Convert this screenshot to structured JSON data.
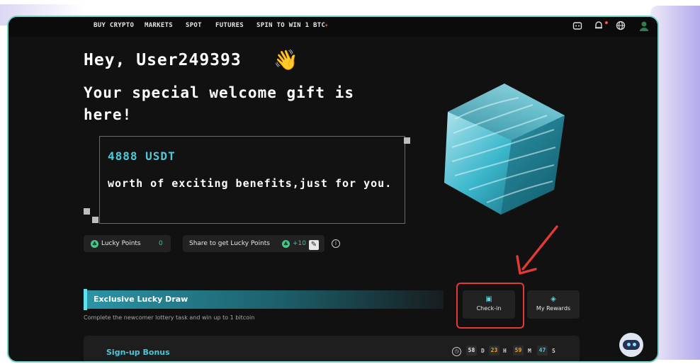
{
  "nav": {
    "items": [
      "BUY CRYPTO",
      "MARKETS",
      "SPOT",
      "FUTURES",
      "SPIN TO WIN 1 BTC"
    ],
    "icons": [
      "gift-icon",
      "bell-icon",
      "globe-icon",
      "avatar-icon"
    ]
  },
  "hero": {
    "greeting": "Hey, User249393",
    "wave_emoji": "👋",
    "welcome": "Your special welcome gift is here!",
    "gift_amount": "4888 USDT",
    "gift_desc": "worth of exciting benefits,just for you."
  },
  "lucky_points": {
    "label": "Lucky Points",
    "value": "0",
    "share_label": "Share to get Lucky Points",
    "share_bonus": "+10"
  },
  "lucky_draw": {
    "title": "Exclusive Lucky Draw",
    "subtitle": "Complete the newcomer lottery task and win up to 1 bitcoin"
  },
  "actions": {
    "checkin_label": "Check-in",
    "rewards_label": "My Rewards"
  },
  "signup": {
    "title": "Sign-up Bonus",
    "timer": {
      "days": "58",
      "days_unit": "D",
      "hours": "23",
      "hours_unit": "H",
      "minutes": "59",
      "minutes_unit": "M",
      "seconds": "47",
      "seconds_unit": "S"
    }
  },
  "colors": {
    "accent": "#4fc9d8",
    "highlight": "#e53935",
    "frame": "#6fd3c2",
    "positive": "#45c58a",
    "timer_hours": "#e9a23b",
    "timer_seconds": "#4fc9d8"
  }
}
